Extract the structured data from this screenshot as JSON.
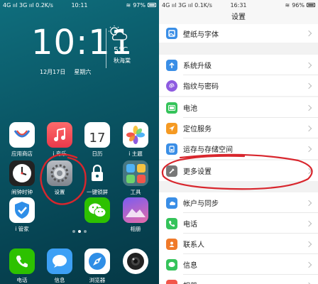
{
  "home": {
    "status": {
      "left": "4G ııl 3G ııl 0.2K/s",
      "time": "10:11",
      "battery": "97%"
    },
    "clock": "10:11",
    "date": "12月17日",
    "weekday": "星期六",
    "temp": "5°C",
    "city": "秋海棠",
    "apps": [
      {
        "label": "应用商店",
        "icon": "app-store-icon"
      },
      {
        "label": "i 音乐",
        "icon": "music-icon"
      },
      {
        "label": "日历",
        "icon": "calendar-icon",
        "day": "17"
      },
      {
        "label": "i 主题",
        "icon": "theme-icon"
      },
      {
        "label": "闹钟时钟",
        "icon": "clock-icon"
      },
      {
        "label": "设置",
        "icon": "settings-gear-icon"
      },
      {
        "label": "一键锁屏",
        "icon": "lock-icon"
      },
      {
        "label": "工具",
        "icon": "tools-folder-icon"
      },
      {
        "label": "i 管家",
        "icon": "shield-icon"
      },
      {
        "label": "",
        "icon": "wechat-icon"
      },
      {
        "label": "相册",
        "icon": "album-icon"
      },
      {
        "label": "电话",
        "icon": "phone-icon"
      },
      {
        "label": "信息",
        "icon": "message-icon"
      },
      {
        "label": "浏览器",
        "icon": "browser-icon"
      },
      {
        "label": "",
        "icon": "camera-icon"
      }
    ]
  },
  "settings": {
    "status": {
      "left": "4G ııl 3G ııl 0.1K/s",
      "time": "16:31",
      "battery": "96%"
    },
    "title": "设置",
    "items": [
      {
        "label": "壁纸与字体",
        "icon": "wallpaper-icon",
        "color": "#3a8ee6"
      },
      {
        "label": "系统升级",
        "icon": "update-icon",
        "color": "#3a8ee6"
      },
      {
        "label": "指纹与密码",
        "icon": "fingerprint-icon",
        "color": "#8e5be0"
      },
      {
        "label": "电池",
        "icon": "battery-icon",
        "color": "#35c35a"
      },
      {
        "label": "定位服务",
        "icon": "location-icon",
        "color": "#f59a23"
      },
      {
        "label": "运存与存储空间",
        "icon": "storage-icon",
        "color": "#3a8ee6"
      },
      {
        "label": "更多设置",
        "icon": "more-settings-icon",
        "color": "#777777"
      },
      {
        "label": "帐户与同步",
        "icon": "account-sync-icon",
        "color": "#3a8ee6"
      },
      {
        "label": "电话",
        "icon": "phone-icon",
        "color": "#35c35a"
      },
      {
        "label": "联系人",
        "icon": "contacts-icon",
        "color": "#f07a2a"
      },
      {
        "label": "信息",
        "icon": "message-icon",
        "color": "#35c35a"
      },
      {
        "label": "相册",
        "icon": "album-icon",
        "color": "#f2564a"
      }
    ]
  }
}
